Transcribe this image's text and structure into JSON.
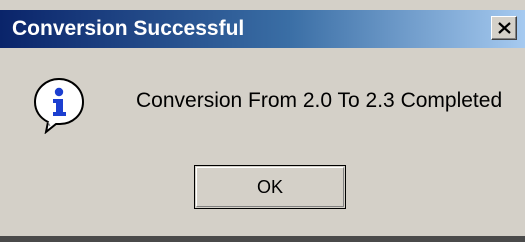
{
  "window": {
    "title": "Conversion Successful",
    "close_icon": "close-icon"
  },
  "content": {
    "icon": "info-icon",
    "message": "Conversion From 2.0 To 2.3 Completed"
  },
  "buttons": {
    "ok_label": "OK"
  },
  "colors": {
    "titlebar_start": "#0a246a",
    "titlebar_end": "#a6caf0",
    "dialog_background": "#d4d0c8",
    "info_blue": "#1c3fd0"
  }
}
